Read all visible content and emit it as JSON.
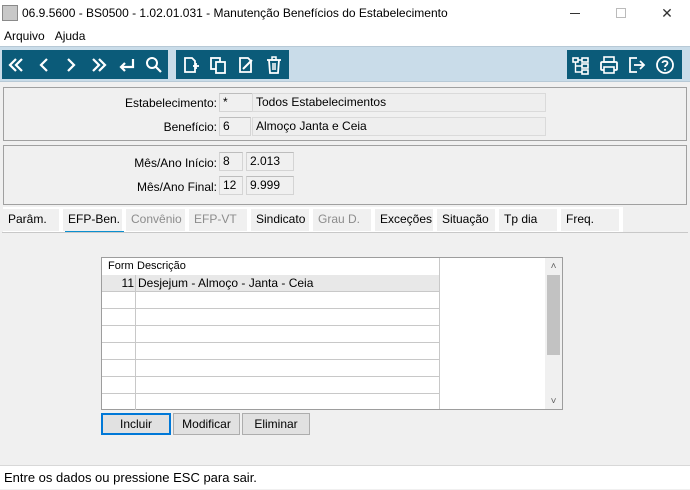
{
  "window": {
    "title": "06.9.5600 - BS0500 - 1.02.01.031 - Manutenção Benefícios do Estabelecimento",
    "minimize": "",
    "maximize": "",
    "close": "✕"
  },
  "menu": {
    "items": [
      "Arquivo",
      "Ajuda"
    ]
  },
  "toolbar": {
    "nav_icons": [
      "first-icon",
      "previous-icon",
      "next-icon",
      "last-icon",
      "goto-icon",
      "search-icon"
    ],
    "edit_icons": [
      "new-icon",
      "copy-icon",
      "edit-icon",
      "delete-icon"
    ],
    "right_icons": [
      "hierarchy-icon",
      "print-icon",
      "exit-icon",
      "help-icon"
    ],
    "colors": {
      "bg": "#c9dce9",
      "button": "#0b5b79"
    }
  },
  "header": {
    "estab_label": "Estabelecimento:",
    "estab_code": "*",
    "estab_desc": "Todos Estabelecimentos",
    "benef_label": "Benefício:",
    "benef_code": "6",
    "benef_desc": "Almoço Janta e Ceia"
  },
  "period": {
    "start_label": "Mês/Ano Início:",
    "start_month": "8",
    "start_year": "2.013",
    "end_label": "Mês/Ano Final:",
    "end_month": "12",
    "end_year": "9.999"
  },
  "tabs": [
    {
      "label": "Parâm.",
      "state": "normal"
    },
    {
      "label": "EFP-Ben.",
      "state": "active"
    },
    {
      "label": "Convênio",
      "state": "disabled"
    },
    {
      "label": "EFP-VT",
      "state": "disabled"
    },
    {
      "label": "Sindicato",
      "state": "normal"
    },
    {
      "label": "Grau D.",
      "state": "disabled"
    },
    {
      "label": "Exceções",
      "state": "normal"
    },
    {
      "label": "Situação",
      "state": "normal"
    },
    {
      "label": "Tp dia",
      "state": "normal"
    },
    {
      "label": "Freq.",
      "state": "normal"
    }
  ],
  "grid": {
    "columns": [
      "Form",
      "Descrição"
    ],
    "rows": [
      {
        "form": "11",
        "descricao": "Desjejum - Almoço - Janta - Ceia"
      }
    ]
  },
  "buttons": {
    "incluir": "Incluir",
    "modificar": "Modificar",
    "eliminar": "Eliminar"
  },
  "status": {
    "message": "Entre os dados ou pressione ESC para sair."
  }
}
